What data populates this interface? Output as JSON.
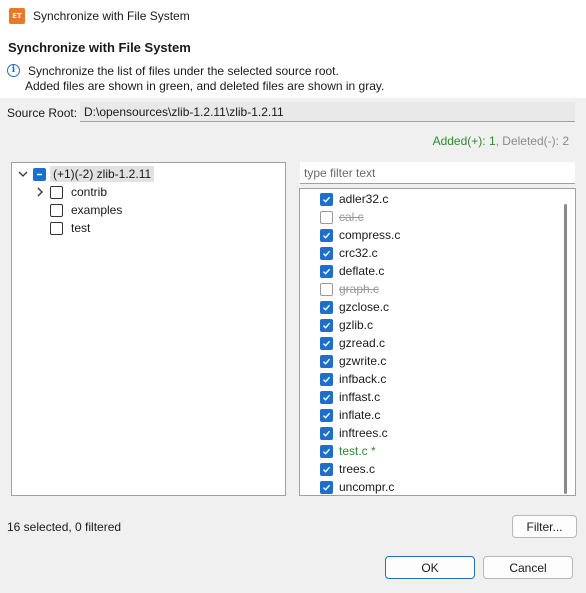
{
  "window": {
    "title": "Synchronize with File System",
    "icon_text": "ET"
  },
  "header": {
    "title": "Synchronize with File System",
    "line1": "Synchronize the list of files under the selected source root.",
    "line2": "Added files are shown in green, and deleted files are shown in gray."
  },
  "source": {
    "label": "Source Root:",
    "value": "D:\\opensources\\zlib-1.2.11\\zlib-1.2.11"
  },
  "counts": {
    "added": "Added(+): 1",
    "separator": ", ",
    "deleted": "Deleted(-): 2"
  },
  "tree": {
    "root": {
      "label": "(+1)(-2) zlib-1.2.11",
      "state": "partial"
    },
    "children": [
      {
        "label": "contrib",
        "expandable": true,
        "checked": false
      },
      {
        "label": "examples",
        "expandable": false,
        "checked": false
      },
      {
        "label": "test",
        "expandable": false,
        "checked": false
      }
    ]
  },
  "filter": {
    "placeholder": "type filter text"
  },
  "files": [
    {
      "name": "adler32.c",
      "checked": true,
      "status": "normal"
    },
    {
      "name": "cal.c",
      "checked": false,
      "status": "deleted"
    },
    {
      "name": "compress.c",
      "checked": true,
      "status": "normal"
    },
    {
      "name": "crc32.c",
      "checked": true,
      "status": "normal"
    },
    {
      "name": "deflate.c",
      "checked": true,
      "status": "normal"
    },
    {
      "name": "graph.c",
      "checked": false,
      "status": "deleted"
    },
    {
      "name": "gzclose.c",
      "checked": true,
      "status": "normal"
    },
    {
      "name": "gzlib.c",
      "checked": true,
      "status": "normal"
    },
    {
      "name": "gzread.c",
      "checked": true,
      "status": "normal"
    },
    {
      "name": "gzwrite.c",
      "checked": true,
      "status": "normal"
    },
    {
      "name": "infback.c",
      "checked": true,
      "status": "normal"
    },
    {
      "name": "inffast.c",
      "checked": true,
      "status": "normal"
    },
    {
      "name": "inflate.c",
      "checked": true,
      "status": "normal"
    },
    {
      "name": "inftrees.c",
      "checked": true,
      "status": "normal"
    },
    {
      "name": "test.c *",
      "checked": true,
      "status": "added"
    },
    {
      "name": "trees.c",
      "checked": true,
      "status": "normal"
    },
    {
      "name": "uncompr.c",
      "checked": true,
      "status": "normal"
    }
  ],
  "status": {
    "text": "16 selected, 0 filtered"
  },
  "buttons": {
    "filter": "Filter...",
    "ok": "OK",
    "cancel": "Cancel"
  },
  "colors": {
    "accent": "#1e6fc9",
    "added": "#2e8b2e",
    "deleted": "#9a9a9a"
  }
}
